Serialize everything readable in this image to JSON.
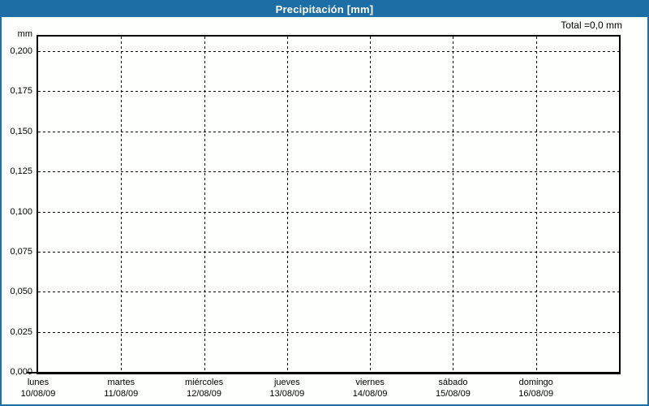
{
  "window": {
    "title": "Precipitación [mm]"
  },
  "annotations": {
    "total": "Total =0,0 mm"
  },
  "chart_data": {
    "type": "bar",
    "title": "Precipitación [mm]",
    "total_annotation": "Total =0,0 mm",
    "xlabel": "",
    "ylabel": "mm",
    "ylim": [
      0,
      0.2125
    ],
    "ytick_values": [
      0.2,
      0.175,
      0.15,
      0.125,
      0.1,
      0.075,
      0.05,
      0.025,
      0.0
    ],
    "ytick_labels": [
      "0,200",
      "0,175",
      "0,150",
      "0,125",
      "0,100",
      "0,075",
      "0,050",
      "0,025",
      "0,000"
    ],
    "categories": [
      "lunes",
      "martes",
      "miércoles",
      "jueves",
      "viernes",
      "sábado",
      "domingo"
    ],
    "category_dates": [
      "10/08/09",
      "11/08/09",
      "12/08/09",
      "13/08/09",
      "14/08/09",
      "15/08/09",
      "16/08/09"
    ],
    "values": [
      0,
      0,
      0,
      0,
      0,
      0,
      0
    ],
    "total_mm": 0.0,
    "grid": "dashed",
    "legend_position": "none"
  },
  "colors": {
    "header_bg": "#1C6EA4",
    "frame_border": "#1C6EA4",
    "page_bg": "#FDFFFD",
    "grid": "#000000",
    "title_text": "#FFFFFF"
  }
}
